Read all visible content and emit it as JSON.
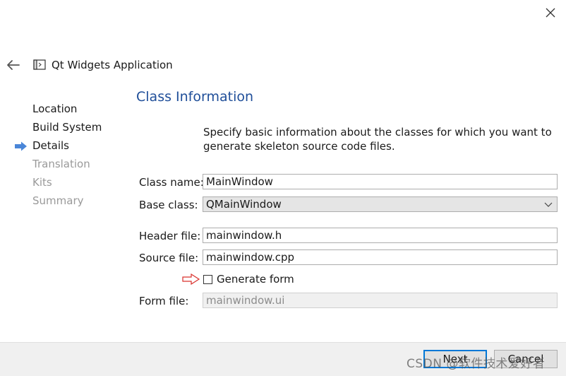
{
  "window": {
    "title": "Qt Widgets Application",
    "close_icon": "close-icon",
    "back_icon": "back-arrow-icon",
    "app_icon": "window-icon"
  },
  "steps": [
    {
      "label": "Location",
      "state": "done"
    },
    {
      "label": "Build System",
      "state": "done"
    },
    {
      "label": "Details",
      "state": "current"
    },
    {
      "label": "Translation",
      "state": "todo"
    },
    {
      "label": "Kits",
      "state": "todo"
    },
    {
      "label": "Summary",
      "state": "todo"
    }
  ],
  "page": {
    "title": "Class Information",
    "description": "Specify basic information about the classes for which you want to generate skeleton source code files."
  },
  "form": {
    "class_name": {
      "label": "Class name:",
      "value": "MainWindow"
    },
    "base_class": {
      "label": "Base class:",
      "value": "QMainWindow"
    },
    "header_file": {
      "label": "Header file:",
      "value": "mainwindow.h"
    },
    "source_file": {
      "label": "Source file:",
      "value": "mainwindow.cpp"
    },
    "generate_form": {
      "label": "Generate form",
      "checked": false
    },
    "form_file": {
      "label": "Form file:",
      "value": "mainwindow.ui",
      "disabled": true
    }
  },
  "footer": {
    "next_label": "Next",
    "cancel_label": "Cancel"
  },
  "watermark": "CSDN @软件技术爱好者",
  "colors": {
    "title_blue": "#1f4e99",
    "step_arrow": "#4a86d8",
    "annotation_arrow": "#d9302c",
    "default_button_border": "#0078d7"
  }
}
